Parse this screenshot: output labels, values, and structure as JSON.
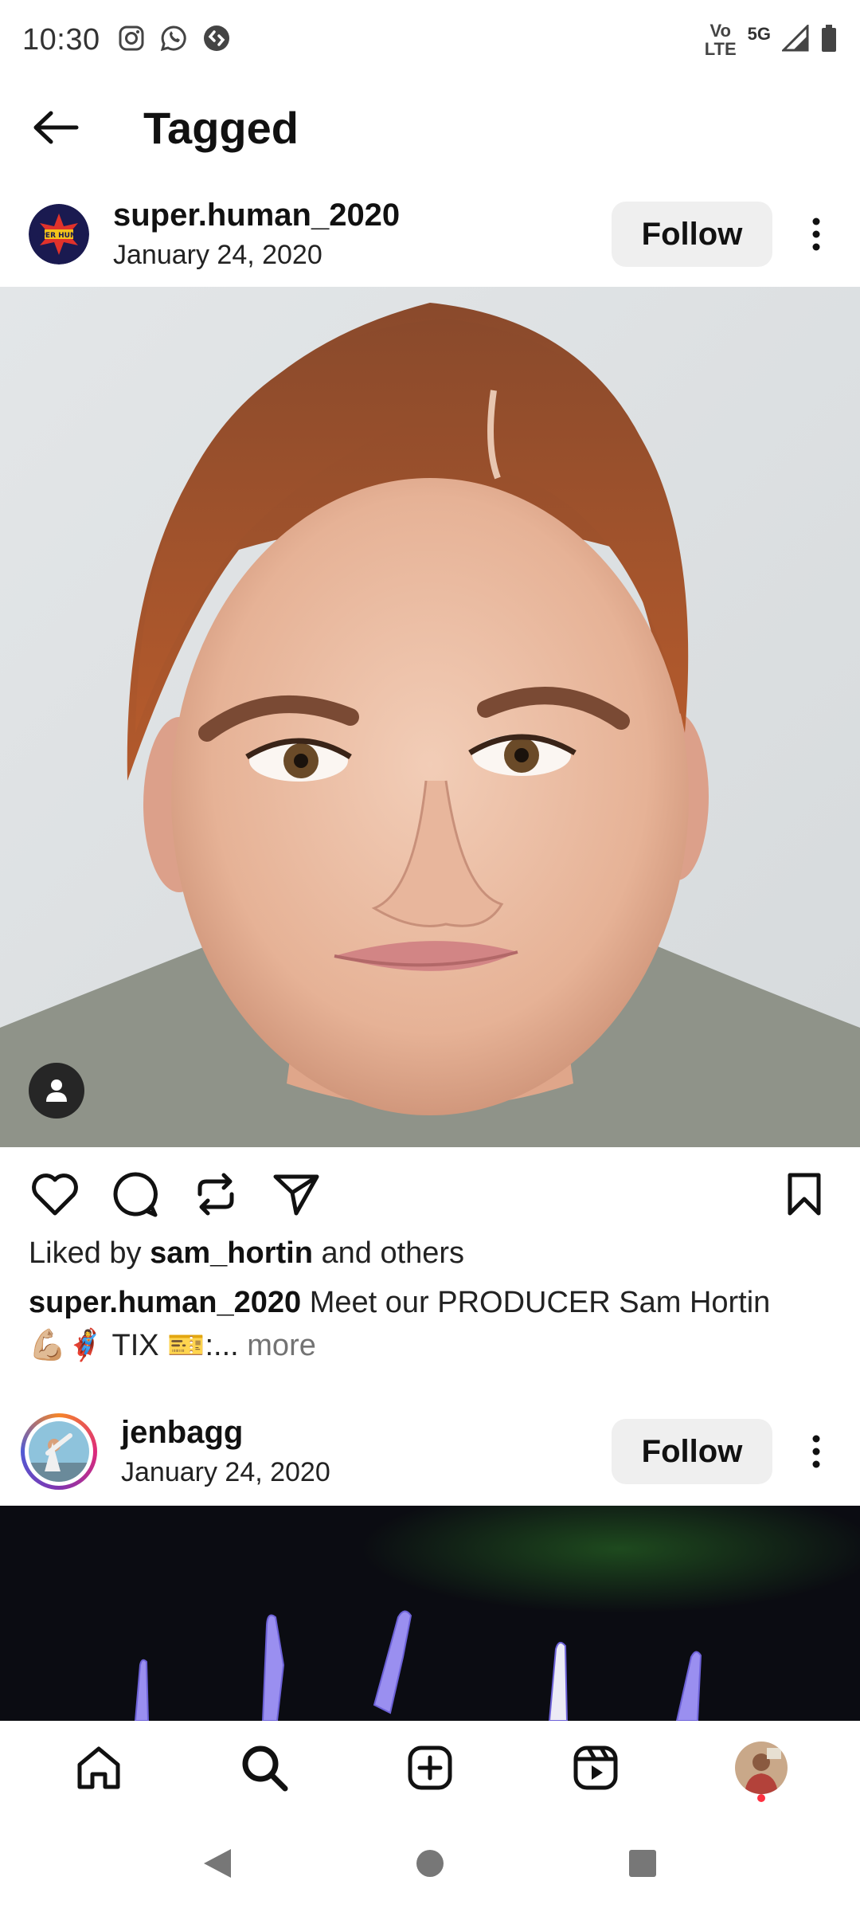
{
  "status_bar": {
    "time": "10:30",
    "left_icons": [
      "instagram-icon",
      "whatsapp-icon",
      "shazam-icon"
    ],
    "network_label_top": "Vo",
    "network_label_bottom": "LTE",
    "network_type": "5G",
    "right_icons": [
      "signal-icon",
      "battery-icon"
    ]
  },
  "header": {
    "title": "Tagged",
    "back_icon": "arrow-left-icon"
  },
  "posts": [
    {
      "username": "super.human_2020",
      "date": "January 24, 2020",
      "follow_label": "Follow",
      "avatar_text": "SUPER HUMAN",
      "likes_prefix": "Liked by ",
      "likes_user": "sam_hortin",
      "likes_suffix": " and others",
      "caption_user": "super.human_2020",
      "caption_text": " Meet our PRODUCER Sam Hortin",
      "caption_line2": "💪🏼🦸‍♀️ TIX 🎫:...",
      "more_label": " more"
    },
    {
      "username": "jenbagg",
      "date": "January 24, 2020",
      "follow_label": "Follow"
    }
  ],
  "actions": [
    "heart-icon",
    "comment-icon",
    "repost-icon",
    "send-icon",
    "bookmark-icon"
  ],
  "bottom_nav": [
    "home-icon",
    "search-icon",
    "create-icon",
    "reels-icon",
    "profile-avatar"
  ],
  "system_nav": [
    "back-triangle-icon",
    "home-circle-icon",
    "recents-square-icon"
  ],
  "colors": {
    "follow_bg": "#efefef",
    "notification_dot": "#ff3040",
    "more_link": "#737373"
  }
}
